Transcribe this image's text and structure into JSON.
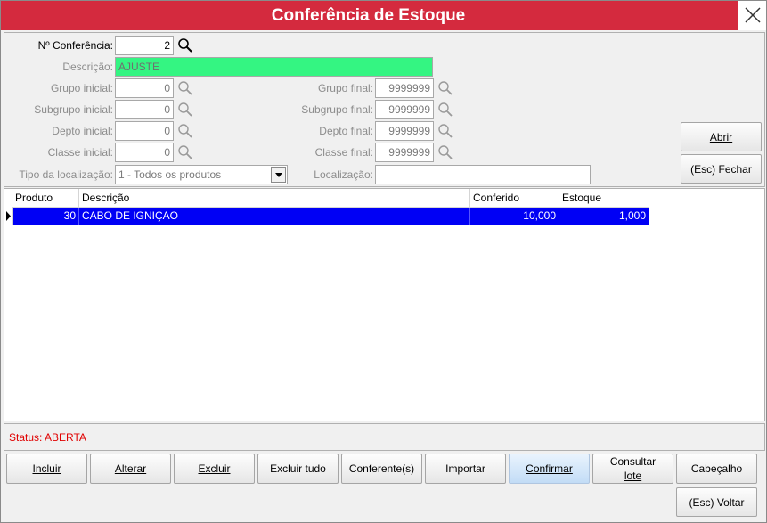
{
  "window": {
    "title": "Conferência de Estoque"
  },
  "filters": {
    "numero_label": "Nº Conferência:",
    "numero_value": "2",
    "descricao_label": "Descrição:",
    "descricao_value": "AJUSTE",
    "grupo_inicial_label": "Grupo inicial:",
    "grupo_inicial_value": "0",
    "grupo_final_label": "Grupo final:",
    "grupo_final_value": "9999999",
    "subgrupo_inicial_label": "Subgrupo inicial:",
    "subgrupo_inicial_value": "0",
    "subgrupo_final_label": "Subgrupo final:",
    "subgrupo_final_value": "9999999",
    "depto_inicial_label": "Depto inicial:",
    "depto_inicial_value": "0",
    "depto_final_label": "Depto final:",
    "depto_final_value": "9999999",
    "classe_inicial_label": "Classe inicial:",
    "classe_inicial_value": "0",
    "classe_final_label": "Classe final:",
    "classe_final_value": "9999999",
    "tipo_localizacao_label": "Tipo da localização:",
    "tipo_localizacao_value": "1 - Todos os produtos",
    "localizacao_label": "Localização:",
    "localizacao_value": ""
  },
  "side_buttons": {
    "abrir_label": "Abrir",
    "fechar_label": "(Esc) Fechar"
  },
  "grid": {
    "columns": [
      "Produto",
      "Descrição",
      "Conferido",
      "Estoque"
    ],
    "rows": [
      {
        "produto": "30",
        "descricao": "CABO DE IGNIÇAO",
        "conferido": "10,000",
        "estoque": "1,000"
      }
    ]
  },
  "status": {
    "text": "Status: ABERTA"
  },
  "toolbar": {
    "incluir_label": "Incluir",
    "alterar_label": "Alterar",
    "excluir_label": "Excluir",
    "excluir_tudo_label": "Excluir tudo",
    "conferentes_label": "Conferente(s)",
    "importar_label": "Importar",
    "confirmar_label": "Confirmar",
    "consultar_lote_label_1": "Consultar",
    "consultar_lote_label_2": "lote",
    "cabecalho_label": "Cabeçalho",
    "voltar_label": "(Esc) Voltar"
  },
  "icons": {
    "search": "magnifier-icon",
    "close": "close-icon",
    "dropdown": "chevron-down-icon",
    "row_pointer": "triangle-right-icon"
  },
  "colors": {
    "titlebar": "#d42a3e",
    "selected_row": "#0000f5",
    "descricao_field": "#34f582",
    "status_text": "#e00000"
  }
}
